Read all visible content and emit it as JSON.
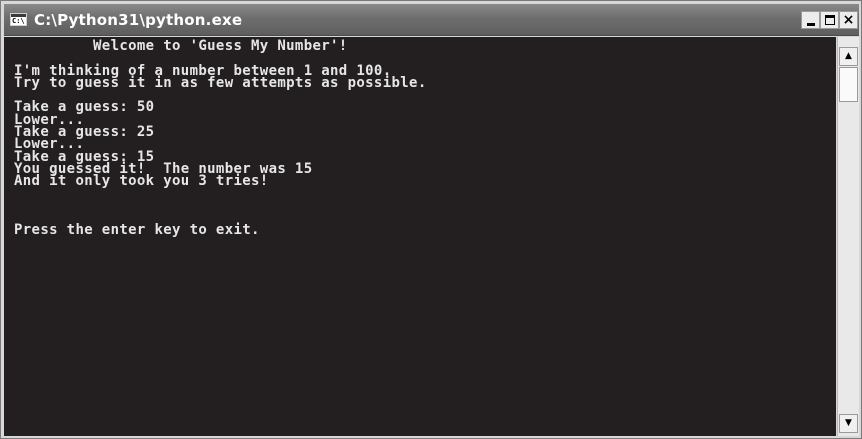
{
  "window": {
    "title": "C:\\Python31\\python.exe",
    "icon_text": "C:\\"
  },
  "title_buttons": {
    "minimize_icon": "minimize-icon",
    "maximize_icon": "maximize-icon",
    "close_label": "×"
  },
  "console": {
    "lines": [
      "         Welcome to 'Guess My Number'!",
      "",
      "I'm thinking of a number between 1 and 100.",
      "Try to guess it in as few attempts as possible.",
      "",
      "Take a guess: 50",
      "Lower...",
      "Take a guess: 25",
      "Lower...",
      "Take a guess: 15",
      "You guessed it!  The number was 15",
      "And it only took you 3 tries!",
      "",
      "",
      "",
      "Press the enter key to exit."
    ]
  },
  "scrollbar": {
    "up_arrow": "▲",
    "down_arrow": "▼"
  }
}
